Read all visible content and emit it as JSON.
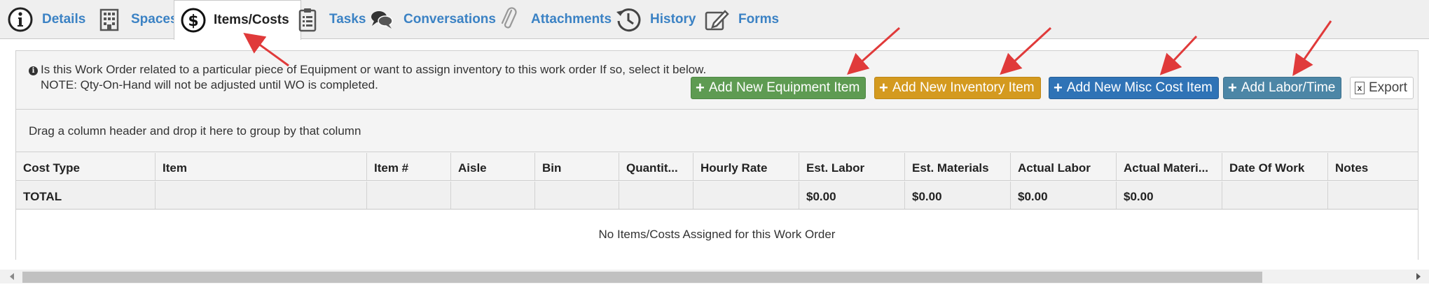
{
  "tabs": [
    {
      "label": "Details",
      "icon": "info-circle-icon"
    },
    {
      "label": "Spaces",
      "icon": "building-icon"
    },
    {
      "label": "Items/Costs",
      "icon": "dollar-circle-icon",
      "active": true
    },
    {
      "label": "Tasks",
      "icon": "clipboard-list-icon"
    },
    {
      "label": "Conversations",
      "icon": "chat-bubbles-icon"
    },
    {
      "label": "Attachments",
      "icon": "paperclip-icon"
    },
    {
      "label": "History",
      "icon": "history-clock-icon"
    },
    {
      "label": "Forms",
      "icon": "form-edit-icon"
    }
  ],
  "info": {
    "line1": "Is this Work Order related to a particular piece of Equipment or want to assign inventory to this work order If so, select it below.",
    "line2": "NOTE: Qty-On-Hand will not be adjusted until WO is completed."
  },
  "buttons": {
    "equipment": "Add New Equipment Item",
    "inventory": "Add New Inventory Item",
    "misc": "Add New Misc Cost Item",
    "labor": "Add Labor/Time",
    "export": "Export"
  },
  "group_hint": "Drag a column header and drop it here to group by that column",
  "columns": [
    "Cost Type",
    "Item",
    "Item #",
    "Aisle",
    "Bin",
    "Quantit...",
    "Hourly Rate",
    "Est. Labor",
    "Est. Materials",
    "Actual Labor",
    "Actual Materi...",
    "Date Of Work",
    "Notes"
  ],
  "total_row": {
    "label": "TOTAL",
    "est_labor": "$0.00",
    "est_materials": "$0.00",
    "actual_labor": "$0.00",
    "actual_materials": "$0.00"
  },
  "empty_message": "No Items/Costs Assigned for this Work Order",
  "colors": {
    "tab_link": "#3b82c4",
    "btn_green": "#5e9b52",
    "btn_orange": "#d49a1f",
    "btn_blue": "#2f73b6",
    "btn_steel": "#4c86a6",
    "annotation_arrow": "#e03a3a"
  }
}
